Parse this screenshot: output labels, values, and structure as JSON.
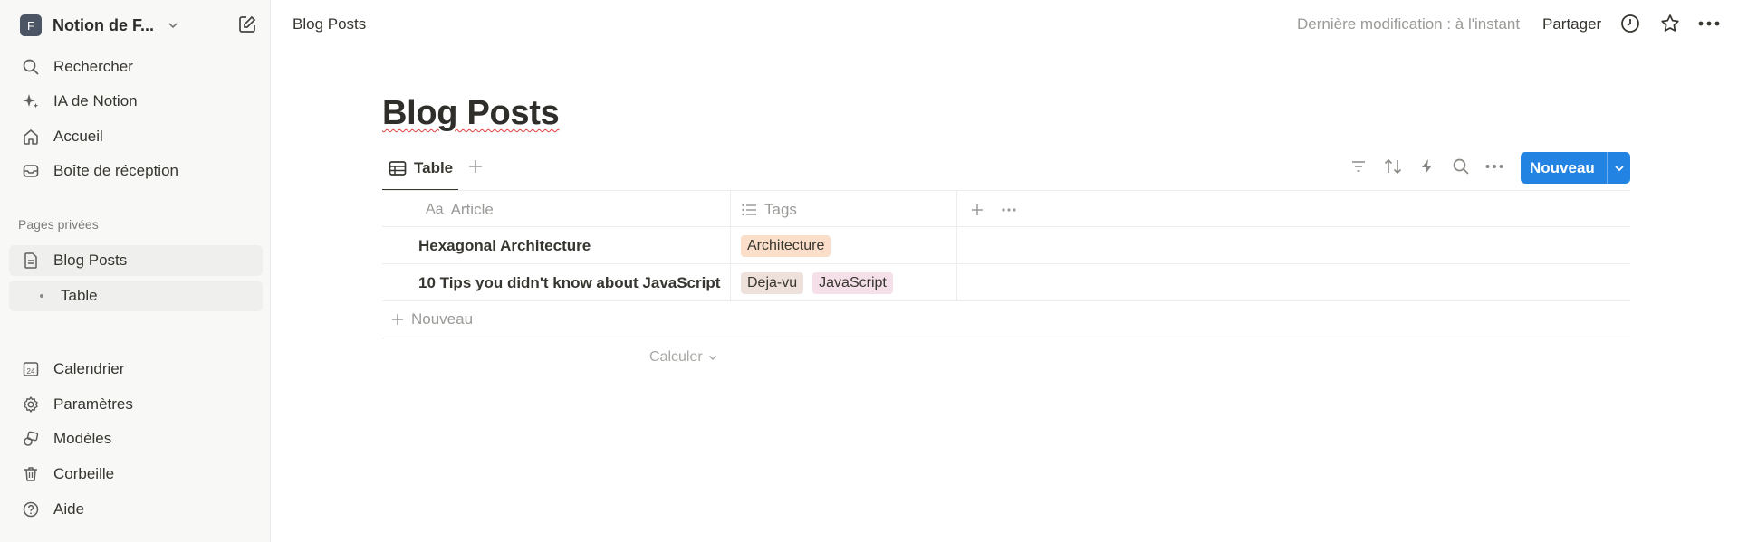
{
  "workspace": {
    "initial": "F",
    "name": "Notion de F..."
  },
  "nav": {
    "search": "Rechercher",
    "ai": "IA de Notion",
    "home": "Accueil",
    "inbox": "Boîte de réception"
  },
  "private_section": {
    "label": "Pages privées",
    "page": "Blog Posts",
    "subpage": "Table"
  },
  "bottom_nav": {
    "calendar": "Calendrier",
    "calendar_icon_text": "24",
    "settings": "Paramètres",
    "templates": "Modèles",
    "trash": "Corbeille",
    "help": "Aide"
  },
  "topbar": {
    "breadcrumb": "Blog Posts",
    "last_modified": "Dernière modification : à l'instant",
    "share": "Partager"
  },
  "page": {
    "title": "Blog Posts"
  },
  "view": {
    "tab_label": "Table"
  },
  "toolbar": {
    "new_label": "Nouveau"
  },
  "table": {
    "columns": [
      {
        "icon_text": "Aa",
        "label": "Article"
      },
      {
        "label": "Tags"
      }
    ],
    "rows": [
      {
        "title": "Hexagonal Architecture",
        "tags": [
          {
            "label": "Architecture",
            "color": "#fadec9"
          }
        ]
      },
      {
        "title": "10 Tips you didn't know about JavaScript",
        "tags": [
          {
            "label": "Deja-vu",
            "color": "#eee0da"
          },
          {
            "label": "JavaScript",
            "color": "#f5e0e9"
          }
        ]
      }
    ],
    "add_row_label": "Nouveau",
    "calculate_label": "Calculer"
  },
  "colors": {
    "accent": "#2383e2"
  }
}
